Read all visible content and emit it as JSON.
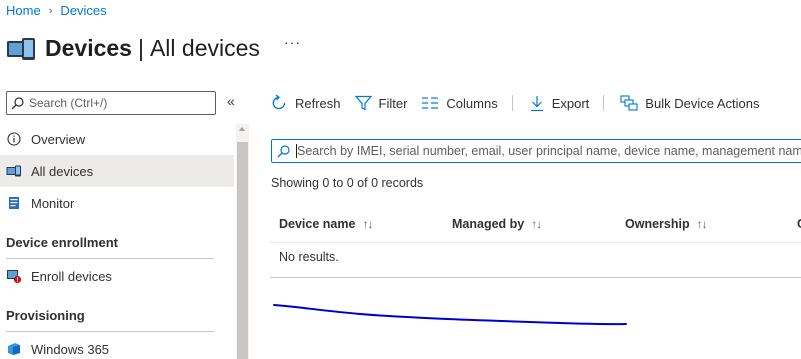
{
  "breadcrumb": {
    "home": "Home",
    "separator": "›",
    "current": "Devices"
  },
  "header": {
    "title": "Devices",
    "separator": "|",
    "subtitle": "All devices",
    "more": "···"
  },
  "sidebar": {
    "search_placeholder": "Search (Ctrl+/)",
    "collapse": "«",
    "items": [
      {
        "label": "Overview",
        "icon": "info-icon",
        "active": false
      },
      {
        "label": "All devices",
        "icon": "devices-icon",
        "active": true
      },
      {
        "label": "Monitor",
        "icon": "monitor-book-icon",
        "active": false
      }
    ],
    "section_enrollment": "Device enrollment",
    "enrollment_items": [
      {
        "label": "Enroll devices",
        "icon": "enroll-devices-icon"
      }
    ],
    "section_provisioning": "Provisioning",
    "provisioning_items": [
      {
        "label": "Windows 365",
        "icon": "windows365-icon"
      }
    ]
  },
  "toolbar": {
    "refresh": "Refresh",
    "filter": "Filter",
    "columns": "Columns",
    "export": "Export",
    "bulk": "Bulk Device Actions"
  },
  "search": {
    "placeholder": "Search by IMEI, serial number, email, user principal name, device name, management name"
  },
  "records_text": "Showing 0 to 0 of 0 records",
  "table": {
    "columns": [
      "Device name",
      "Managed by",
      "Ownership",
      "C"
    ],
    "sort_glyph": "↑↓",
    "empty_text": "No results."
  },
  "colors": {
    "accent": "#0078d4",
    "scribble": "#0000cc",
    "active_bg": "#edebe9"
  }
}
